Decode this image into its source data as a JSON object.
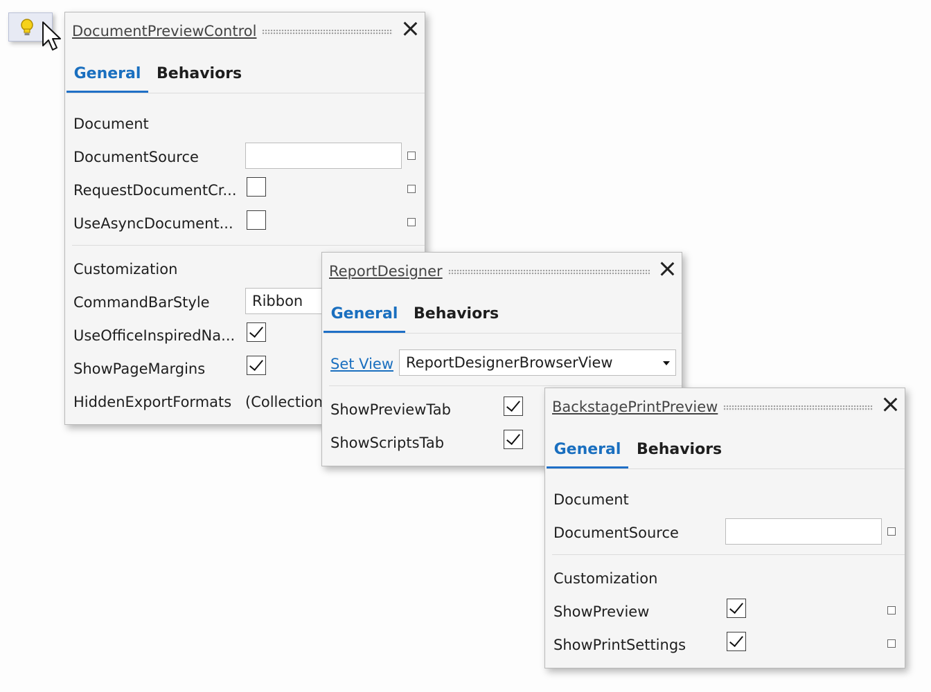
{
  "smart_tag": {
    "icon": "lightbulb-icon",
    "arrow_icon": "triangle-right-icon"
  },
  "panel1": {
    "title": "DocumentPreviewControl",
    "tabs": [
      "General",
      "Behaviors"
    ],
    "section1": "Document",
    "rows": [
      {
        "label": "DocumentSource"
      },
      {
        "label": "RequestDocumentCr...",
        "checked": false
      },
      {
        "label": "UseAsyncDocument...",
        "checked": false
      }
    ],
    "section2": "Customization",
    "rows2": [
      {
        "label": "CommandBarStyle",
        "value": "Ribbon"
      },
      {
        "label": "UseOfficeInspiredNa...",
        "checked": true
      },
      {
        "label": "ShowPageMargins",
        "checked": true
      },
      {
        "label": "HiddenExportFormats",
        "value": "(Collection"
      }
    ]
  },
  "panel2": {
    "title": "ReportDesigner",
    "tabs": [
      "General",
      "Behaviors"
    ],
    "set_view_link": "Set View",
    "view_value": "ReportDesignerBrowserView",
    "rows": [
      {
        "label": "ShowPreviewTab",
        "checked": true
      },
      {
        "label": "ShowScriptsTab",
        "checked": true
      }
    ]
  },
  "panel3": {
    "title": "BackstagePrintPreview",
    "tabs": [
      "General",
      "Behaviors"
    ],
    "section1": "Document",
    "rows": [
      {
        "label": "DocumentSource"
      }
    ],
    "section2": "Customization",
    "rows2": [
      {
        "label": "ShowPreview",
        "checked": true
      },
      {
        "label": "ShowPrintSettings",
        "checked": true
      }
    ]
  },
  "colors": {
    "accent": "#1a6fbf",
    "panel_bg": "#f5f5f5"
  }
}
